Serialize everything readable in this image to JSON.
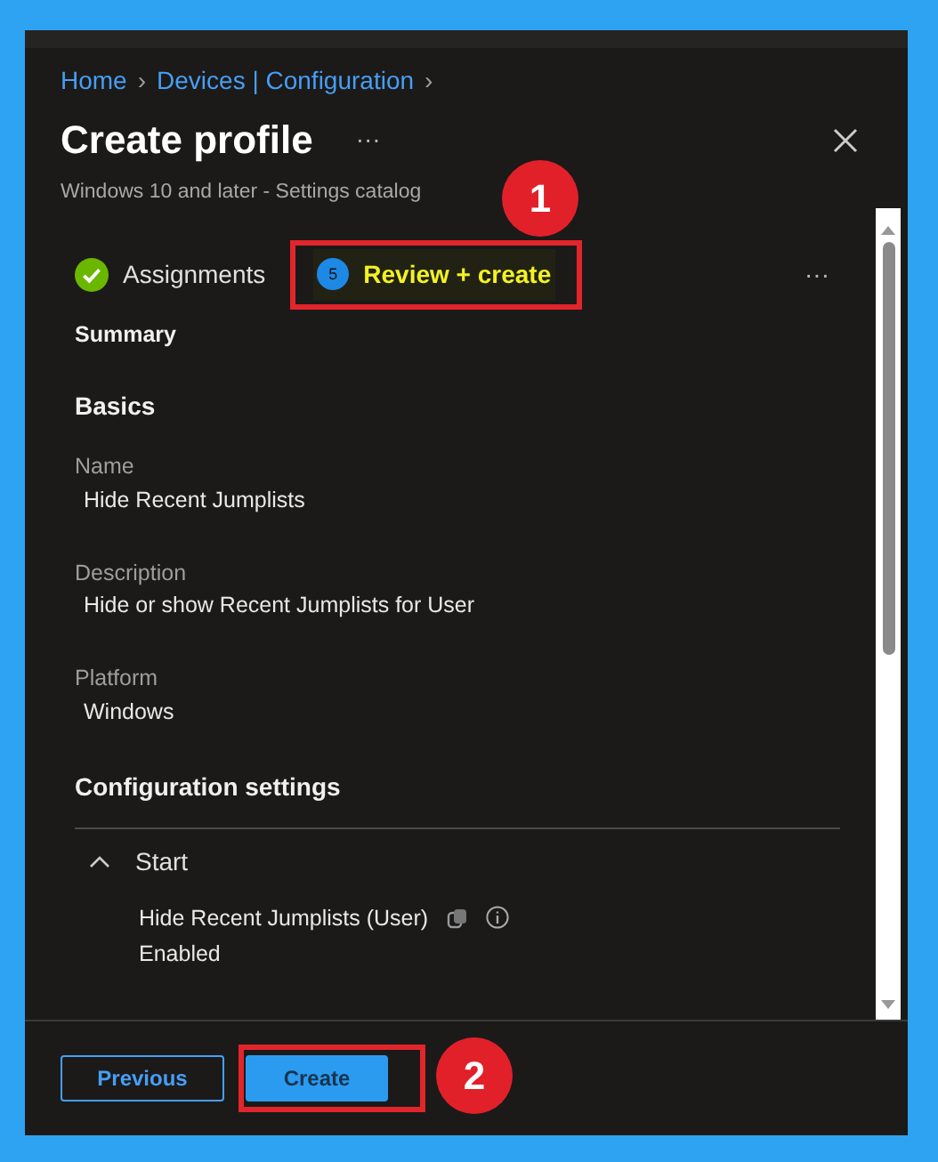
{
  "breadcrumb": [
    {
      "label": "Home",
      "separator": "›"
    },
    {
      "label": "Devices | Configuration",
      "separator": "›"
    }
  ],
  "title": "Create profile",
  "title_menu": "···",
  "subtitle": "Windows 10 and later - Settings catalog",
  "tabs": [
    {
      "label": "Assignments",
      "kind": "done",
      "selected": false
    },
    {
      "label": "Review + create",
      "kind": "step",
      "step": "5",
      "selected": true,
      "callout": "1"
    }
  ],
  "tabs_menu": "···",
  "summary_heading": "Summary",
  "basics": {
    "heading": "Basics",
    "fields": [
      {
        "label": "Name",
        "value": "Hide Recent Jumplists"
      },
      {
        "label": "Description",
        "value": "Hide or show Recent Jumplists for User"
      },
      {
        "label": "Platform",
        "value": "Windows"
      }
    ]
  },
  "configuration": {
    "heading": "Configuration settings",
    "group": {
      "label": "Start",
      "expanded": true,
      "settings": [
        {
          "name": "Hide Recent Jumplists (User)",
          "value": "Enabled"
        }
      ]
    }
  },
  "buttons": [
    {
      "label": "Previous",
      "kind": "secondary"
    },
    {
      "label": "Create",
      "kind": "primary",
      "callout": "2"
    }
  ]
}
